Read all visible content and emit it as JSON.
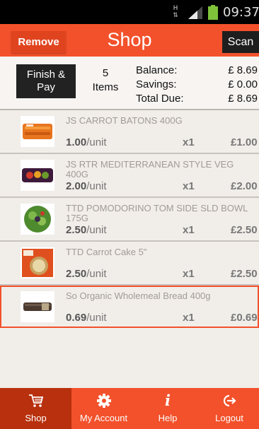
{
  "status_bar": {
    "network": "H",
    "time": "09:37"
  },
  "header": {
    "title": "Shop",
    "remove_label": "Remove",
    "scan_label": "Scan"
  },
  "summary": {
    "finish_line1": "Finish &",
    "finish_line2": "Pay",
    "items_count": "5",
    "items_label": "Items",
    "balance_label": "Balance:",
    "balance_value": "£ 8.69",
    "savings_label": "Savings:",
    "savings_value": "£ 0.00",
    "total_label": "Total Due:",
    "total_value": "£ 8.69"
  },
  "items": [
    {
      "name": "JS CARROT BATONS 400G",
      "unit_price": "1.00",
      "unit_suffix": "/unit",
      "qty": "x1",
      "total": "£1.00",
      "thumb": "carrot-batons"
    },
    {
      "name": "JS RTR MEDITERRANEAN STYLE VEG 400G",
      "unit_price": "2.00",
      "unit_suffix": "/unit",
      "qty": "x1",
      "total": "£2.00",
      "thumb": "mediterranean-veg"
    },
    {
      "name": "TTD POMODORINO TOM SIDE SLD BOWL 175G",
      "unit_price": "2.50",
      "unit_suffix": "/unit",
      "qty": "x1",
      "total": "£2.50",
      "thumb": "salad-bowl"
    },
    {
      "name": "TTD Carrot Cake 5\"",
      "unit_price": "2.50",
      "unit_suffix": "/unit",
      "qty": "x1",
      "total": "£2.50",
      "thumb": "carrot-cake"
    },
    {
      "name": "So Organic Wholemeal Bread 400g",
      "unit_price": "0.69",
      "unit_suffix": "/unit",
      "qty": "x1",
      "total": "£0.69",
      "thumb": "bread-loaf"
    }
  ],
  "nav": [
    {
      "label": "Shop",
      "icon": "cart-icon"
    },
    {
      "label": "My Account",
      "icon": "gear-icon"
    },
    {
      "label": "Help",
      "icon": "info-icon"
    },
    {
      "label": "Logout",
      "icon": "logout-icon"
    }
  ],
  "colors": {
    "accent": "#f2512b",
    "active_nav": "#b8300d",
    "dark_button": "#222222"
  }
}
